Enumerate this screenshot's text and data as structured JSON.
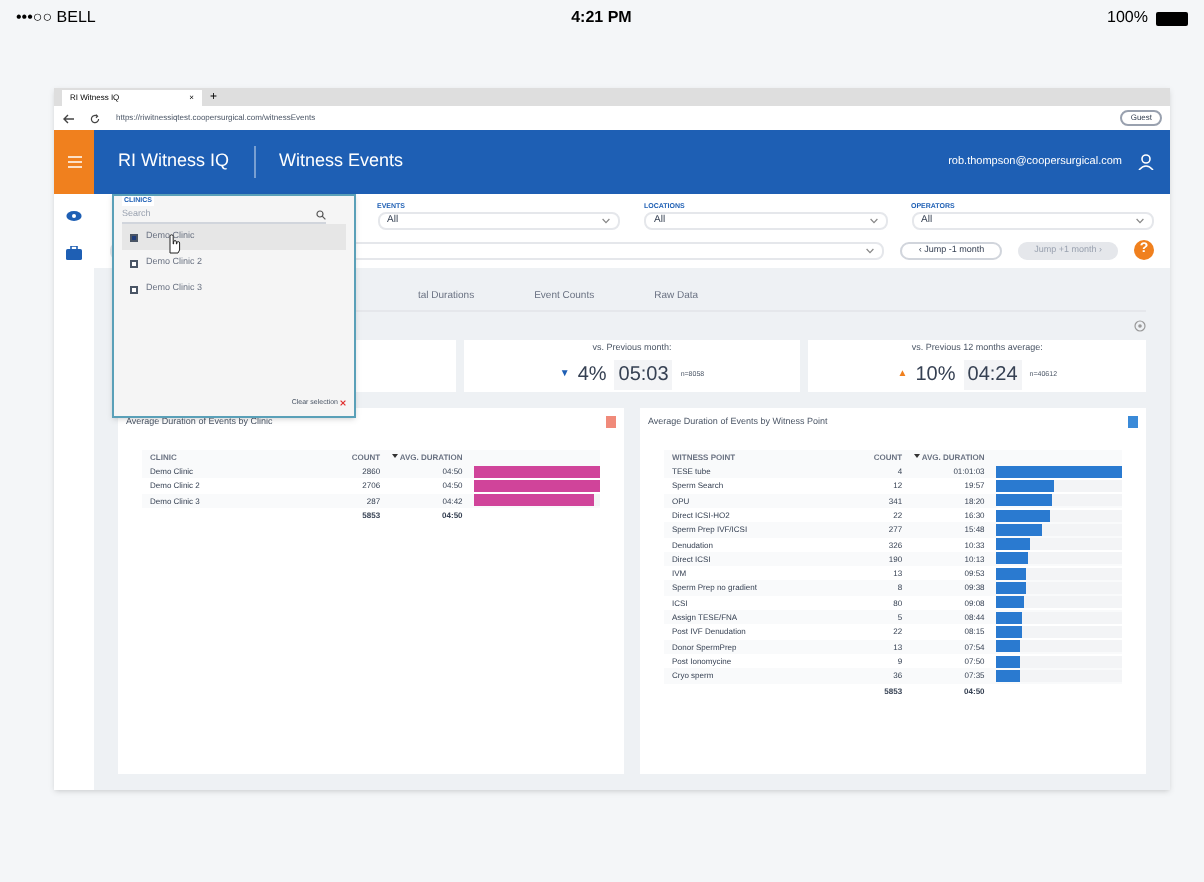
{
  "status_bar": {
    "carrier": "•••○○ BELL",
    "time": "4:21 PM",
    "battery": "100%"
  },
  "browser": {
    "tab": "RI Witness IQ",
    "close": "×",
    "new_tab": "+",
    "url": "https://riwitnessiqtest.coopersurgical.com/witnessEvents",
    "profile": "Guest"
  },
  "header": {
    "app": "RI Witness IQ",
    "page": "Witness Events",
    "user": "rob.thompson@coopersurgical.com"
  },
  "filters": [
    {
      "label": "EVENTS",
      "value": "All"
    },
    {
      "label": "LOCATIONS",
      "value": "All"
    },
    {
      "label": "OPERATORS",
      "value": "All"
    }
  ],
  "clinic_dropdown": {
    "label": "CLINICS",
    "placeholder": "Search",
    "options": [
      {
        "label": "Demo Clinic",
        "checked": true,
        "hovered": true
      },
      {
        "label": "Demo Clinic 2",
        "checked": false,
        "hovered": false
      },
      {
        "label": "Demo Clinic 3",
        "checked": false,
        "hovered": false
      }
    ],
    "clear": "Clear selection"
  },
  "jump_buttons": [
    {
      "label": "‹ Jump -1 month",
      "disabled": false
    },
    {
      "label": "Jump +1 month ›",
      "disabled": true
    }
  ],
  "help": "?",
  "tabs": [
    {
      "label": "tal Durations",
      "selected": false
    },
    {
      "label": "Event Counts",
      "selected": false
    },
    {
      "label": "Raw Data",
      "selected": false
    }
  ],
  "kpis": [
    {
      "title": "vs. Previous month:",
      "arrow": "▼",
      "color": "#1e5fb4",
      "percent": "4%",
      "time": "05:03",
      "n": "n=8058"
    },
    {
      "title": "vs. Previous 12 months average:",
      "arrow": "▲",
      "color": "#f0801e",
      "percent": "10%",
      "time": "04:24",
      "n": "n=40612"
    }
  ],
  "clinic_table": {
    "title": "Average Duration of Events by Clinic",
    "columns": [
      "CLINIC",
      "COUNT",
      "AVG. DURATION"
    ],
    "rows": [
      {
        "name": "Demo Clinic",
        "count": "2860",
        "duration": "04:50",
        "level": 1.0
      },
      {
        "name": "Demo Clinic 2",
        "count": "2706",
        "duration": "04:50",
        "level": 1.0
      },
      {
        "name": "Demo Clinic 3",
        "count": "287",
        "duration": "04:42",
        "level": 0.96
      }
    ],
    "total_count": "5853",
    "total_duration": "04:50"
  },
  "witness_table": {
    "title": "Average Duration of Events by Witness Point",
    "columns": [
      "WITNESS POINT",
      "COUNT",
      "AVG. DURATION"
    ],
    "rows": [
      {
        "name": "TESE tube",
        "count": "4",
        "duration": "01:01:03",
        "level": 1.0
      },
      {
        "name": "Sperm Search",
        "count": "12",
        "duration": "19:57",
        "level": 0.46
      },
      {
        "name": "OPU",
        "count": "341",
        "duration": "18:20",
        "level": 0.44
      },
      {
        "name": "Direct ICSI-HO2",
        "count": "22",
        "duration": "16:30",
        "level": 0.42
      },
      {
        "name": "Sperm Prep IVF/ICSI",
        "count": "277",
        "duration": "15:48",
        "level": 0.36
      },
      {
        "name": "Denudation",
        "count": "326",
        "duration": "10:33",
        "level": 0.26
      },
      {
        "name": "Direct ICSI",
        "count": "190",
        "duration": "10:13",
        "level": 0.25
      },
      {
        "name": "IVM",
        "count": "13",
        "duration": "09:53",
        "level": 0.24
      },
      {
        "name": "Sperm Prep no gradient",
        "count": "8",
        "duration": "09:38",
        "level": 0.23
      },
      {
        "name": "ICSI",
        "count": "80",
        "duration": "09:08",
        "level": 0.22
      },
      {
        "name": "Assign TESE/FNA",
        "count": "5",
        "duration": "08:44",
        "level": 0.21
      },
      {
        "name": "Post IVF Denudation",
        "count": "22",
        "duration": "08:15",
        "level": 0.2
      },
      {
        "name": "Donor SpermPrep",
        "count": "13",
        "duration": "07:54",
        "level": 0.19
      },
      {
        "name": "Post Ionomycine",
        "count": "9",
        "duration": "07:50",
        "level": 0.19
      },
      {
        "name": "Cryo sperm",
        "count": "36",
        "duration": "07:35",
        "level": 0.18
      }
    ],
    "total_count": "5853",
    "total_duration": "04:50"
  }
}
